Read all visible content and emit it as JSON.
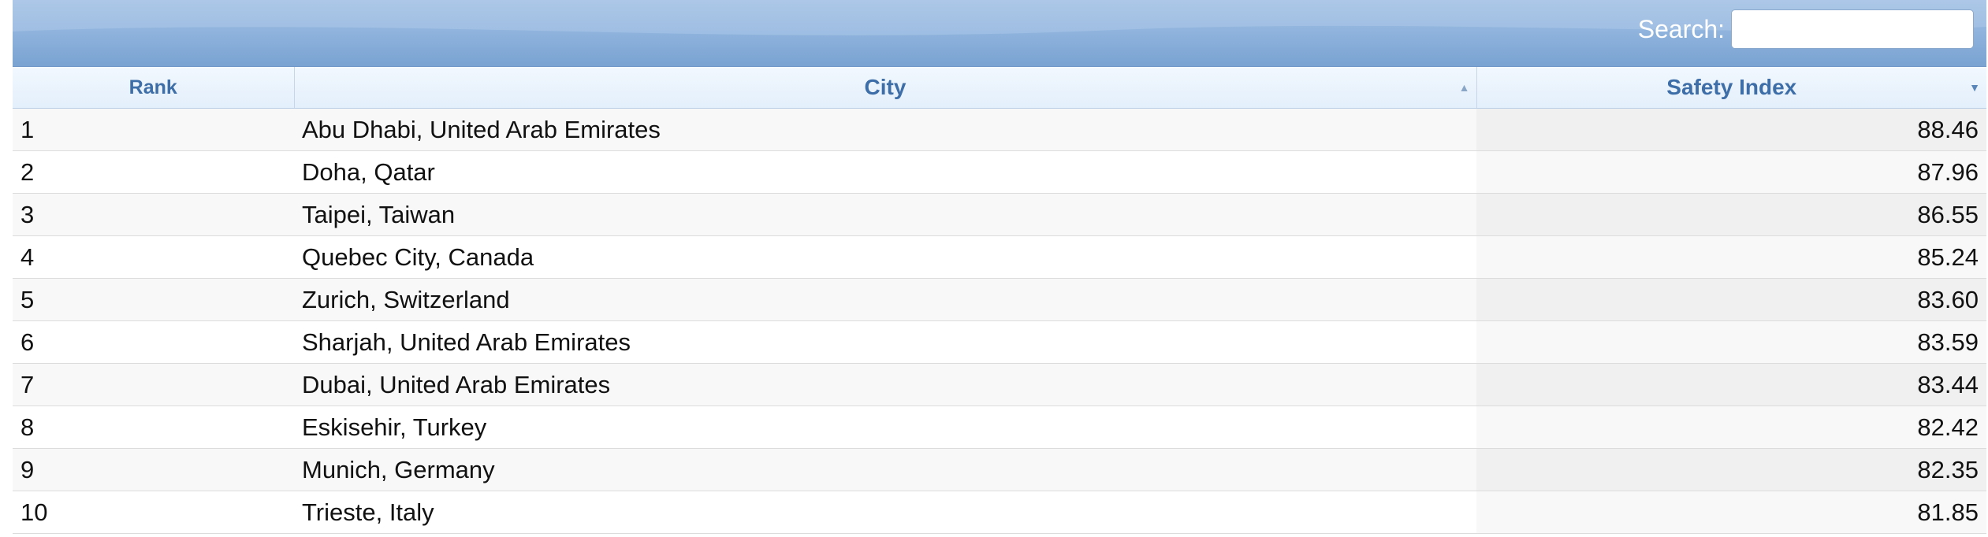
{
  "search": {
    "label": "Search:",
    "value": "",
    "placeholder": ""
  },
  "table": {
    "columns": [
      "Rank",
      "City",
      "Safety Index"
    ],
    "sort": {
      "city": "ascending-indicator",
      "safety_index": "descending-indicator"
    },
    "rows": [
      {
        "rank": "1",
        "city": "Abu Dhabi, United Arab Emirates",
        "safety_index": "88.46"
      },
      {
        "rank": "2",
        "city": "Doha, Qatar",
        "safety_index": "87.96"
      },
      {
        "rank": "3",
        "city": "Taipei, Taiwan",
        "safety_index": "86.55"
      },
      {
        "rank": "4",
        "city": "Quebec City, Canada",
        "safety_index": "85.24"
      },
      {
        "rank": "5",
        "city": "Zurich, Switzerland",
        "safety_index": "83.60"
      },
      {
        "rank": "6",
        "city": "Sharjah, United Arab Emirates",
        "safety_index": "83.59"
      },
      {
        "rank": "7",
        "city": "Dubai, United Arab Emirates",
        "safety_index": "83.44"
      },
      {
        "rank": "8",
        "city": "Eskisehir, Turkey",
        "safety_index": "82.42"
      },
      {
        "rank": "9",
        "city": "Munich, Germany",
        "safety_index": "82.35"
      },
      {
        "rank": "10",
        "city": "Trieste, Italy",
        "safety_index": "81.85"
      }
    ]
  },
  "icons": {
    "city_sort": "sort-asc-icon",
    "safety_sort": "sort-desc-icon"
  },
  "colors": {
    "header_bar": "#90b4dd",
    "column_header_text": "#3e6ea7"
  }
}
